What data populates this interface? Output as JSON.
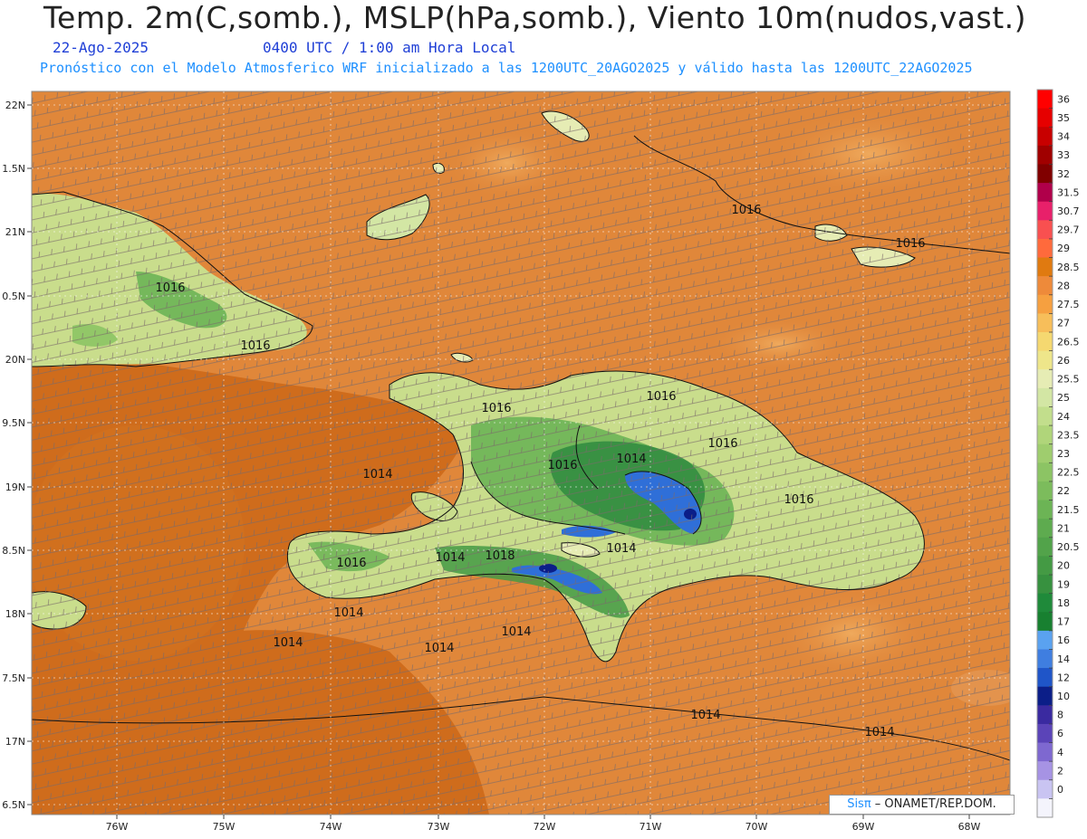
{
  "header": {
    "title": "Temp. 2m(C,somb.), MSLP(hPa,somb.), Viento 10m(nudos,vast.)",
    "date": "22-Ago-2025",
    "time": "0400 UTC / 1:00 am Hora Local",
    "description": "Pronóstico con el Modelo Atmosferico WRF inicializado a las 1200UTC_20AGO2025 y válido hasta las  1200UTC_22AGO2025"
  },
  "axes": {
    "lon_labels": [
      "76W",
      "75W",
      "74W",
      "73W",
      "72W",
      "71W",
      "70W",
      "69W",
      "68W"
    ],
    "lat_labels": [
      "22N",
      "1.5N",
      "21N",
      "0.5N",
      "20N",
      "9.5N",
      "19N",
      "8.5N",
      "18N",
      "7.5N",
      "17N",
      "6.5N"
    ]
  },
  "colorbar": {
    "levels": [
      "36",
      "35",
      "34",
      "33",
      "32",
      "31.5",
      "30.7",
      "29.7",
      "29",
      "28.5",
      "28",
      "27.5",
      "27",
      "26.5",
      "26",
      "25.5",
      "25",
      "24",
      "23.5",
      "23",
      "22.5",
      "22",
      "21.5",
      "21",
      "20.5",
      "20",
      "19",
      "18",
      "17",
      "16",
      "14",
      "12",
      "10",
      "8",
      "6",
      "4",
      "2",
      "0"
    ],
    "colors": [
      "#ff0000",
      "#e60000",
      "#c80000",
      "#a00000",
      "#800000",
      "#b0004a",
      "#e8206a",
      "#f85050",
      "#ff6a3c",
      "#e07a10",
      "#ee8a3a",
      "#f6a040",
      "#f7be5a",
      "#f5d870",
      "#eee68a",
      "#e6ecb4",
      "#d3e6a4",
      "#c2de8c",
      "#b0d57a",
      "#9fcd6e",
      "#8cc464",
      "#7cbc5c",
      "#6cb455",
      "#5eab4f",
      "#52a34a",
      "#449a44",
      "#37913f",
      "#1f8a3a",
      "#188030",
      "#5aa2f0",
      "#3f7ee0",
      "#1f55c8",
      "#0b1e88",
      "#3a2aa0",
      "#5b44b8",
      "#7e68d0",
      "#a693e4",
      "#c9c4f2",
      "#f4f4fc"
    ]
  },
  "map": {
    "colors": {
      "ocean_warm": "#e0873a",
      "ocean_dark": "#cf6c1c",
      "land_light": "#c9dd8c",
      "land_mid": "#8cc464",
      "land_dark": "#2f8a40",
      "mountain_blue": "#2f6fd8",
      "mountain_deep": "#0b1e88",
      "isobar": "#111111",
      "barb": "#7a6a6a"
    },
    "isobar_labels": [
      "1016",
      "1016",
      "1016",
      "1016",
      "1016",
      "1016",
      "1016",
      "1016",
      "1016",
      "1016",
      "1018",
      "1014",
      "1014",
      "1014",
      "1014",
      "1014",
      "1014",
      "1014",
      "1014",
      "1014",
      "1014"
    ]
  },
  "credit": {
    "logo_text": "Sisπ",
    "text": " – ONAMET/REP.DOM."
  }
}
